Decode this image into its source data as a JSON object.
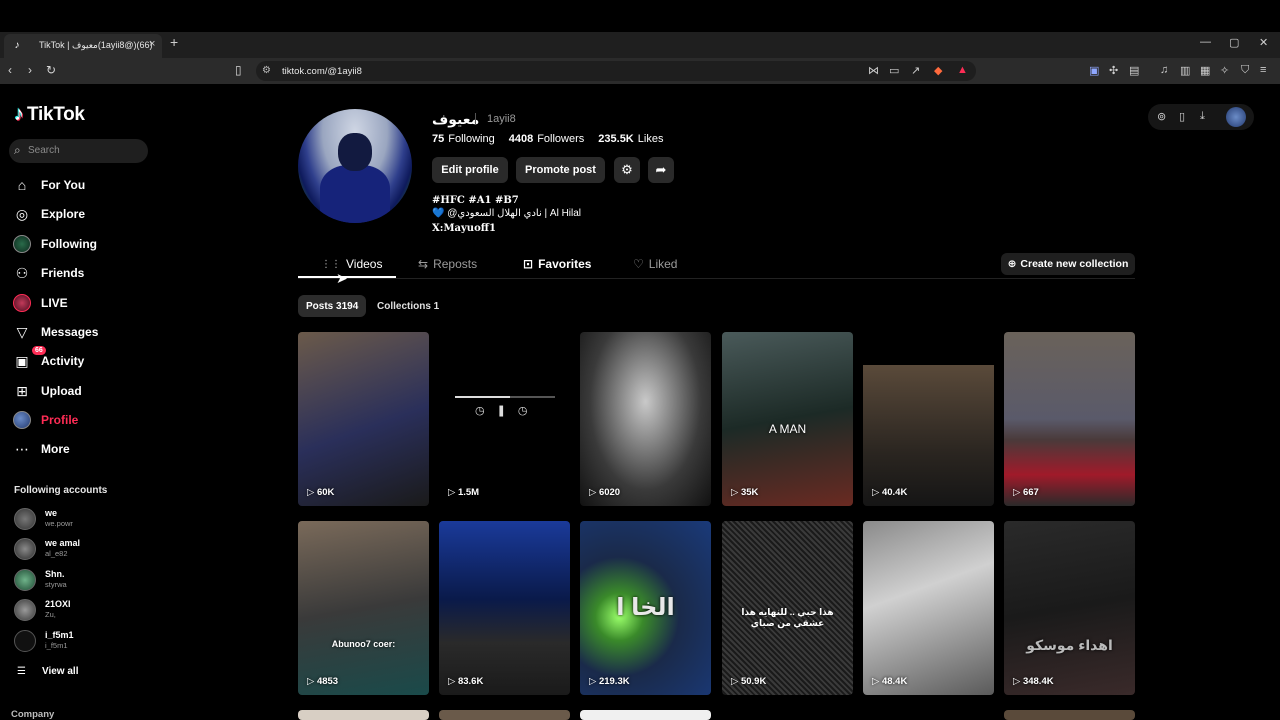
{
  "browser": {
    "tab_title": "TikTok | معيوف(1ayii8@)(66)",
    "tab_close": "×",
    "new_tab": "+",
    "url": "tiktok.com/@1ayii8"
  },
  "sidebar": {
    "logo_text": "TikTok",
    "search_placeholder": "Search",
    "nav": [
      {
        "label": "For You",
        "icon": "home-icon"
      },
      {
        "label": "Explore",
        "icon": "compass-icon"
      },
      {
        "label": "Following",
        "icon": "following-avatar-icon"
      },
      {
        "label": "Friends",
        "icon": "friends-icon"
      },
      {
        "label": "LIVE",
        "icon": "live-icon"
      },
      {
        "label": "Messages",
        "icon": "paper-plane-icon"
      },
      {
        "label": "Activity",
        "icon": "activity-icon",
        "badge": "66"
      },
      {
        "label": "Upload",
        "icon": "plus-square-icon"
      },
      {
        "label": "Profile",
        "icon": "profile-avatar-icon"
      },
      {
        "label": "More",
        "icon": "more-icon"
      }
    ],
    "following_title": "Following accounts",
    "accounts": [
      {
        "name": "we",
        "handle": "we.powr"
      },
      {
        "name": "we amal",
        "handle": "al_e82"
      },
      {
        "name": "Shn.",
        "handle": "styrwa"
      },
      {
        "name": "21OXI",
        "handle": "Zu,"
      },
      {
        "name": "i_f5m1",
        "handle": "i_f5m1"
      }
    ],
    "view_all": "View all",
    "company": "Company"
  },
  "profile": {
    "name": "معيوف",
    "handle": "1ayii8",
    "following_count": "75",
    "following_label": "Following",
    "followers_count": "4408",
    "followers_label": "Followers",
    "likes_count": "235.5K",
    "likes_label": "Likes",
    "edit_profile": "Edit profile",
    "promote_post": "Promote post",
    "bio_line1": "#HFC #A1 #B7",
    "bio_line2": "💙 @نادي الهلال السعودي | Al Hilal",
    "bio_line3": "X:Mayuoff1"
  },
  "tabs": {
    "videos": "Videos",
    "reposts": "Reposts",
    "favorites": "Favorites",
    "liked": "Liked",
    "create_collection": "Create new collection",
    "posts_chip": "Posts 3194",
    "collections_chip": "Collections 1"
  },
  "videos": [
    {
      "views": "60K",
      "caption": ""
    },
    {
      "views": "1.5M",
      "caption": ""
    },
    {
      "views": "6020",
      "caption": ""
    },
    {
      "views": "35K",
      "caption": "A MAN"
    },
    {
      "views": "40.4K",
      "caption": ""
    },
    {
      "views": "667",
      "caption": ""
    },
    {
      "views": "4853",
      "caption": "Abunoo7 coer:"
    },
    {
      "views": "83.6K",
      "caption": ""
    },
    {
      "views": "219.3K",
      "caption": "الخا ا"
    },
    {
      "views": "50.9K",
      "caption": "هذا حبي .. للنهايه هذا عشقي من صباي"
    },
    {
      "views": "48.4K",
      "caption": ""
    },
    {
      "views": "348.4K",
      "caption": "اهداء موسكو"
    }
  ],
  "colors": {
    "accent": "#fe2c55",
    "bg": "#000000",
    "button_bg": "#2a2a2a"
  }
}
